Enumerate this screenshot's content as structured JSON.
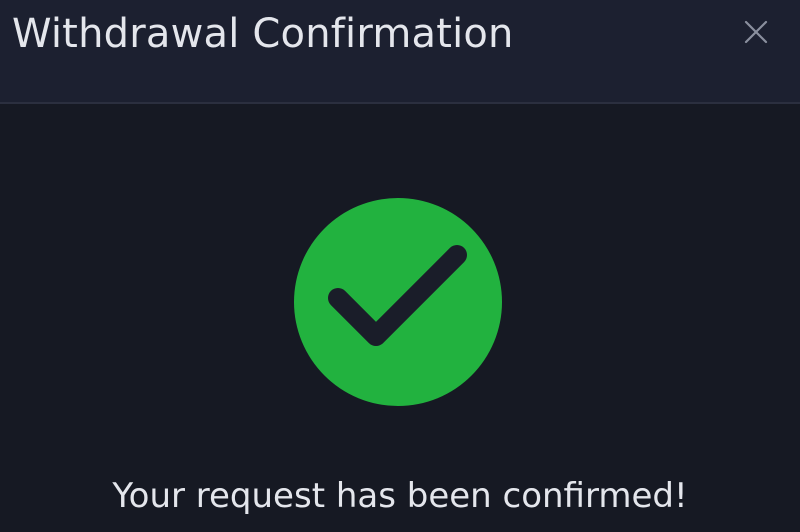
{
  "dialog": {
    "title": "Withdrawal Confirmation",
    "close_icon": "close-icon",
    "status_icon": "check-circle-icon",
    "message": "Your request has been confirmed!"
  },
  "colors": {
    "background": "#161923",
    "header_background": "#1c2030",
    "header_border": "#2b2f3f",
    "text": "#e4e6ec",
    "close_icon": "#8a8f9e",
    "success": "#22b23f",
    "checkmark": "#1a1d29"
  }
}
